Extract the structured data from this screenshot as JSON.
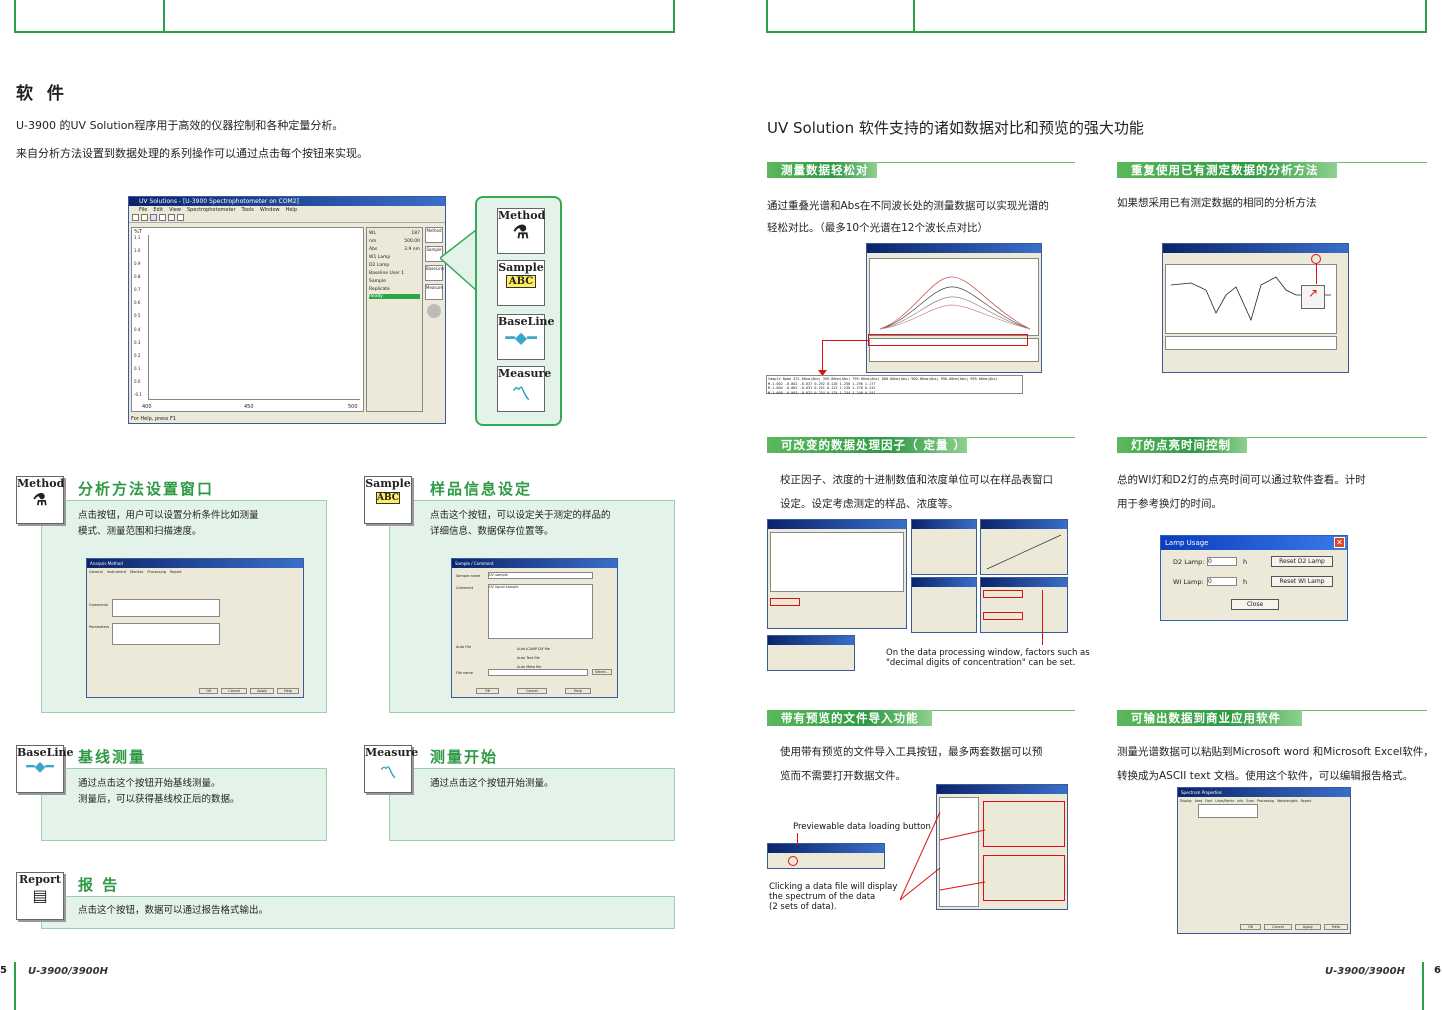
{
  "left": {
    "title": "软 件",
    "intro1": "U-3900 的UV Solution程序用于高效的仪器控制和各种定量分析。",
    "intro2": "来自分析方法设置到数据处理的系列操作可以通过点击每个按钮来实现。",
    "main_window": {
      "title": "UV Solutions - [U-3900 Spectrophotometer on COM2]",
      "menu": [
        "File",
        "Edit",
        "View",
        "Spectrophotometer",
        "Tools",
        "Window",
        "Help"
      ],
      "y_label": "%T",
      "y_ticks": [
        "1.1",
        "1.0",
        "0.9",
        "0.8",
        "0.7",
        "0.6",
        "0.5",
        "0.4",
        "0.3",
        "0.2",
        "0.1",
        "0.0",
        "-0.1"
      ],
      "x_ticks": [
        "400",
        "450",
        "500"
      ],
      "x_unit": "nm",
      "status": "For Help, press F1",
      "side_labels": [
        "WL",
        "nm",
        "Abs",
        "Sample",
        "Replicate",
        "Baseline"
      ],
      "side_values": [
        "187",
        "500.00",
        "3.9 nm",
        "W1 Lamp",
        "D2 Lamp",
        "User 1"
      ],
      "side_status": "Ready"
    },
    "buttons": [
      "Method",
      "Sample",
      "BaseLine",
      "Measure"
    ],
    "features": [
      {
        "icon": "Method",
        "title": "分析方法设置窗口",
        "desc1": "点击按钮，用户可以设置分析条件比如测量",
        "desc2": "模式、测量范围和扫描速度。"
      },
      {
        "icon": "Sample",
        "title": "样品信息设定",
        "desc1": "点击这个按钮，可以设定关于测定的样品的",
        "desc2": "详细信息、数据保存位置等。"
      },
      {
        "icon": "BaseLine",
        "title": "基线测量",
        "desc1": "通过点击这个按钮开始基线测量。",
        "desc2": "测量后，可以获得基线校正后的数据。"
      },
      {
        "icon": "Measure",
        "title": "测量开始",
        "desc1": "通过点击这个按钮开始测量。",
        "desc2": ""
      },
      {
        "icon": "Report",
        "title": "报 告",
        "desc1": "点击这个按钮，数据可以通过报告格式输出。",
        "desc2": ""
      }
    ],
    "method_dialog": {
      "title": "Analysis Method",
      "tabs": [
        "General",
        "Instrument",
        "Monitor",
        "Processing",
        "Report"
      ],
      "fields": [
        "Measurement",
        "Operator",
        "Instrument",
        "Sample",
        "Comments",
        "Parameters"
      ],
      "buttons": [
        "OK",
        "Cancel",
        "Apply",
        "Help"
      ]
    },
    "sample_dialog": {
      "title": "Sample / Comment",
      "sample_name_label": "Sample name",
      "sample_name": "UV sample",
      "comment_label": "Comment",
      "comment": "UV liquid sample",
      "auto_file": "Auto File",
      "file_name": "File name",
      "opts": [
        "Auto JCAMP-DX file",
        "Auto Text file",
        "Auto Meta file"
      ],
      "select": "Select...",
      "buttons": [
        "OK",
        "Cancel",
        "Help"
      ]
    },
    "page_num": "5",
    "footer": "U-3900/3900H"
  },
  "right": {
    "heading": "UV Solution 软件支持的诸如数据对比和预览的强大功能",
    "sections": [
      {
        "bar": "测量数据轻松对比",
        "text1": "通过重叠光谱和Abs在不同波长处的测量数据可以实现光谱的",
        "text2": "轻松对比。（最多10个光谱在12个波长点对比）"
      },
      {
        "bar": "重复使用已有测定数据的分析方法",
        "text1": "如果想采用已有测定数据的相同的分析方法",
        "text2": ""
      },
      {
        "bar": "可改变的数据处理因子（ 定量 ）",
        "text1": "校正因子、浓度的十进制数值和浓度单位可以在样品表窗口",
        "text2": "设定。设定考虑测定的样品、浓度等。"
      },
      {
        "bar": "灯的点亮时间控制",
        "text1": "总的WI灯和D2灯的点亮时间可以通过软件查看。计时",
        "text2": "用于参考换灯的时间。"
      },
      {
        "bar": "带有预览的文件导入功能",
        "text1": "使用带有预览的文件导入工具按钮，最多两套数据可以预",
        "text2": "览而不需要打开数据文件。"
      },
      {
        "bar": "可输出数据到商业应用软件",
        "text1": "测量光谱数据可以粘贴到Microsoft word 和Microsoft Excel软件，",
        "text2": "转换成为ASCII text 文档。使用这个软件，可以编辑报告格式。"
      }
    ],
    "table_header": [
      "Sample Name",
      "321.00nm(Abs)",
      "399.00nm(Abs)",
      "799.00nm(Abs)",
      "800.00nm(Abs)",
      "900.00nm(Abs)",
      "990.00nm(Abs)",
      "999.00nm(Abs)"
    ],
    "table_rows": [
      [
        "M-1-002",
        "-0.002",
        "-0.037",
        "0.292",
        "0.126",
        "1.256",
        "1.296",
        "1.177"
      ],
      [
        "M-1-004",
        "-0.002",
        "-0.031",
        "0.251",
        "0.123",
        "1.230",
        "1.278",
        "0.242"
      ],
      [
        "M-1-005",
        "-0.003",
        "-0.022",
        "0.234",
        "0.125",
        "1.234",
        "1.240",
        "0.247"
      ]
    ],
    "processing_caption1": "On the data processing window, factors such as",
    "processing_caption2": "\"decimal digits of concentration\" can be set.",
    "lamp_dialog": {
      "title": "Lamp Usage",
      "d2_label": "D2 Lamp:",
      "d2_value": "0",
      "wi_label": "WI Lamp:",
      "wi_value": "0",
      "unit": "h",
      "reset_d2": "Reset D2 Lamp",
      "reset_wi": "Reset WI Lamp",
      "close": "Close"
    },
    "preview_btn_caption": "Previewable data loading button",
    "click_caption1": "Clicking a data file will display",
    "click_caption2": "the spectrum of the data",
    "click_caption3": "(2 sets of data).",
    "export_dialog": {
      "title": "Spectrum Properties",
      "tabs": [
        "Display",
        "Axes",
        "Font",
        "Lines/Points",
        "Info",
        "Scan",
        "Processing",
        "Wavelengths",
        "Report"
      ],
      "buttons": [
        "OK",
        "Cancel",
        "Apply",
        "Help"
      ]
    },
    "page_num": "6",
    "footer": "U-3900/3900H"
  }
}
